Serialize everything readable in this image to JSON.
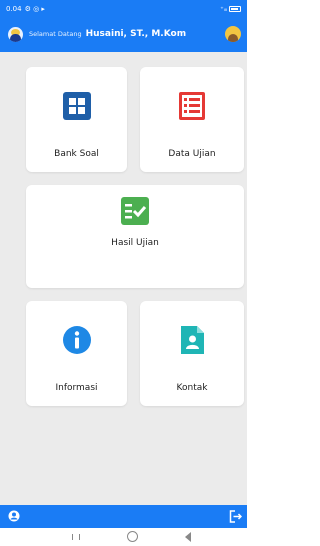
{
  "status_bar": {
    "time": "0.04",
    "left_icons": "⚙ ◎ ▸",
    "right_text": "⁺ᵢₗₗ"
  },
  "header": {
    "welcome_label": "Selamat Datang",
    "user_name": "Husaini, ST., M.Kom"
  },
  "menu": {
    "bank_soal": "Bank Soal",
    "data_ujian": "Data Ujian",
    "hasil_ujian": "Hasil Ujian",
    "informasi": "Informasi",
    "kontak": "Kontak"
  },
  "colors": {
    "primary": "#1a7cf5",
    "bank_icon": "#1f5fa8",
    "data_icon": "#e53935",
    "hasil_icon": "#4caf50",
    "info_icon": "#1e88e5",
    "kontak_icon": "#1fb5b5"
  }
}
